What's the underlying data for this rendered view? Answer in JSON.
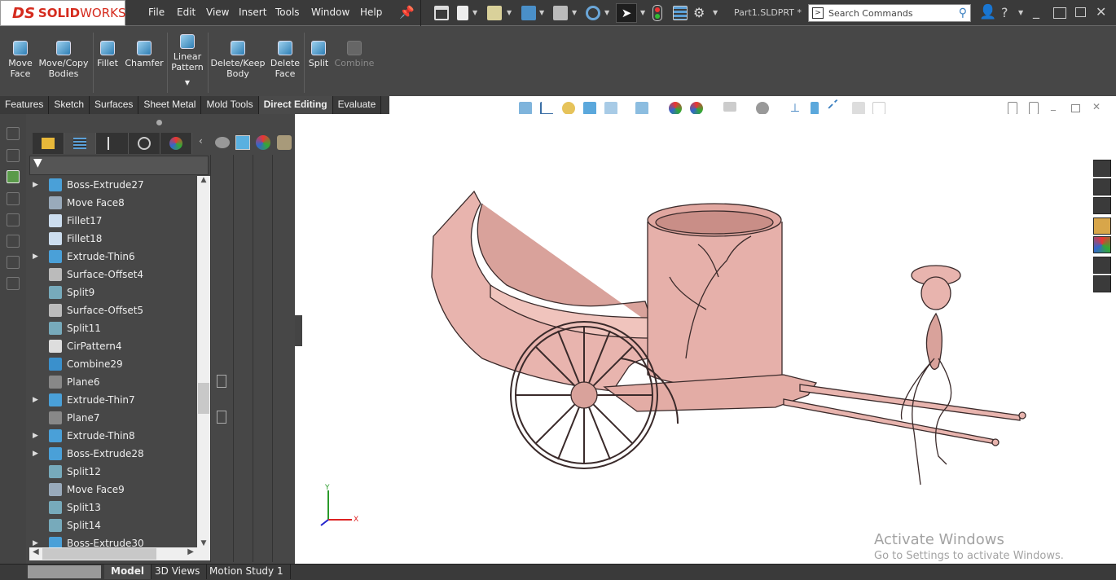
{
  "app": {
    "brand_ds": "DS",
    "brand_solid": "SOLID",
    "brand_works": "WORKS",
    "document_title": "Part1.SLDPRT *"
  },
  "menu": [
    "File",
    "Edit",
    "View",
    "Insert",
    "Tools",
    "Window",
    "Help"
  ],
  "search": {
    "placeholder": "Search Commands"
  },
  "command_manager": [
    {
      "label": "Move\nFace",
      "enabled": true
    },
    {
      "label": "Move/Copy\nBodies",
      "enabled": true
    },
    {
      "label": "Fillet",
      "enabled": true
    },
    {
      "label": "Chamfer",
      "enabled": true
    },
    {
      "label": "Linear\nPattern",
      "enabled": true
    },
    {
      "label": "Delete/Keep\nBody",
      "enabled": true
    },
    {
      "label": "Delete\nFace",
      "enabled": true
    },
    {
      "label": "Split",
      "enabled": true
    },
    {
      "label": "Combine",
      "enabled": false
    }
  ],
  "tabs": [
    {
      "label": "Features"
    },
    {
      "label": "Sketch"
    },
    {
      "label": "Surfaces"
    },
    {
      "label": "Sheet Metal"
    },
    {
      "label": "Mold Tools"
    },
    {
      "label": "Direct Editing",
      "active": true
    },
    {
      "label": "Evaluate"
    }
  ],
  "feature_tree": [
    {
      "label": "Boss-Extrude27",
      "expandable": true,
      "icon": "extrude-icon"
    },
    {
      "label": "Move Face8",
      "expandable": false,
      "icon": "move-face-icon"
    },
    {
      "label": "Fillet17",
      "expandable": false,
      "icon": "fillet-icon"
    },
    {
      "label": "Fillet18",
      "expandable": false,
      "icon": "fillet-icon"
    },
    {
      "label": "Extrude-Thin6",
      "expandable": true,
      "icon": "extrude-icon"
    },
    {
      "label": "Surface-Offset4",
      "expandable": false,
      "icon": "surface-offset-icon"
    },
    {
      "label": "Split9",
      "expandable": false,
      "icon": "split-icon"
    },
    {
      "label": "Surface-Offset5",
      "expandable": false,
      "icon": "surface-offset-icon"
    },
    {
      "label": "Split11",
      "expandable": false,
      "icon": "split-icon"
    },
    {
      "label": "CirPattern4",
      "expandable": false,
      "icon": "circular-pattern-icon"
    },
    {
      "label": "Combine29",
      "expandable": false,
      "icon": "combine-icon"
    },
    {
      "label": "Plane6",
      "expandable": false,
      "icon": "plane-icon"
    },
    {
      "label": "Extrude-Thin7",
      "expandable": true,
      "icon": "extrude-icon"
    },
    {
      "label": "Plane7",
      "expandable": false,
      "icon": "plane-icon"
    },
    {
      "label": "Extrude-Thin8",
      "expandable": true,
      "icon": "extrude-icon"
    },
    {
      "label": "Boss-Extrude28",
      "expandable": true,
      "icon": "extrude-icon"
    },
    {
      "label": "Split12",
      "expandable": false,
      "icon": "split-icon"
    },
    {
      "label": "Move Face9",
      "expandable": false,
      "icon": "move-face-icon"
    },
    {
      "label": "Split13",
      "expandable": false,
      "icon": "split-icon"
    },
    {
      "label": "Split14",
      "expandable": false,
      "icon": "split-icon"
    },
    {
      "label": "Boss-Extrude30",
      "expandable": true,
      "icon": "extrude-icon"
    }
  ],
  "bottom_tabs": [
    {
      "label": "Model",
      "active": true
    },
    {
      "label": "3D Views"
    },
    {
      "label": "Motion Study 1"
    }
  ],
  "triad": {
    "x": "X",
    "y": "Y"
  },
  "watermark": {
    "line1": "Activate Windows",
    "line2": "Go to Settings to activate Windows."
  },
  "colors": {
    "model": "#e8b4ae",
    "accent": "#d52b1e",
    "panel": "#474747"
  }
}
